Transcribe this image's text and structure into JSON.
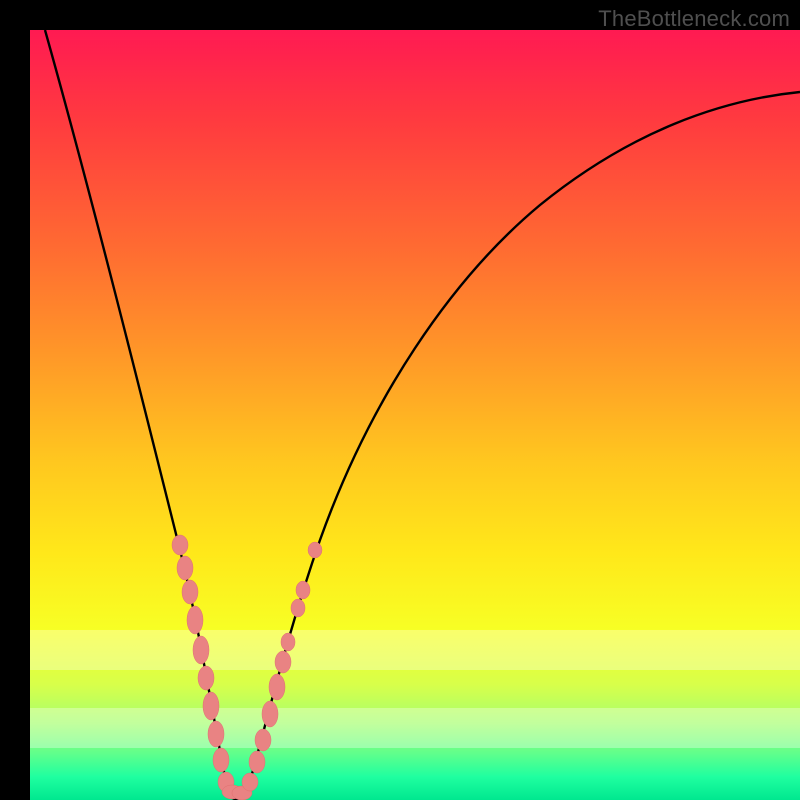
{
  "watermark": {
    "text": "TheBottleneck.com"
  },
  "chart_data": {
    "type": "line",
    "title": "",
    "xlabel": "",
    "ylabel": "",
    "xlim": [
      0,
      100
    ],
    "ylim": [
      0,
      100
    ],
    "grid": false,
    "legend": false,
    "series": [
      {
        "name": "bottleneck-curve",
        "color": "#000000",
        "x": [
          2,
          4,
          6,
          8,
          10,
          12,
          14,
          16,
          18,
          20,
          22,
          24,
          25,
          26,
          27,
          28,
          30,
          32,
          34,
          36,
          40,
          45,
          50,
          55,
          60,
          66,
          72,
          78,
          84,
          90,
          96,
          100
        ],
        "y": [
          100,
          92,
          84,
          77,
          70,
          63,
          56,
          50,
          43,
          36,
          26,
          10,
          2,
          0,
          0,
          2,
          10,
          20,
          30,
          38,
          49,
          58,
          65,
          71,
          75,
          79,
          82,
          85,
          87,
          88.5,
          89.5,
          90
        ]
      },
      {
        "name": "data-points",
        "color": "#e98383",
        "type": "scatter",
        "x": [
          19,
          20,
          21,
          22,
          22.5,
          23,
          24,
          24.5,
          25,
          25.5,
          26,
          26.5,
          27,
          27.5,
          28,
          28.5,
          29,
          30,
          30.5,
          32,
          32.5,
          33,
          34
        ],
        "y": [
          40,
          36,
          32,
          26,
          22,
          18,
          12,
          7,
          3,
          1,
          0,
          0,
          1,
          2,
          4,
          7,
          10,
          17,
          20,
          28,
          31,
          34,
          42
        ]
      }
    ],
    "bands": [
      {
        "name": "pale-band-upper",
        "y0": 78,
        "y1": 83,
        "opacity": 0.32
      },
      {
        "name": "pale-band-lower",
        "y0": 88,
        "y1": 93,
        "opacity": 0.32
      }
    ],
    "colors": {
      "gradient_top": "#ff1a52",
      "gradient_bottom": "#00e88f",
      "curve": "#000000",
      "points": "#e98383",
      "frame": "#000000"
    }
  }
}
